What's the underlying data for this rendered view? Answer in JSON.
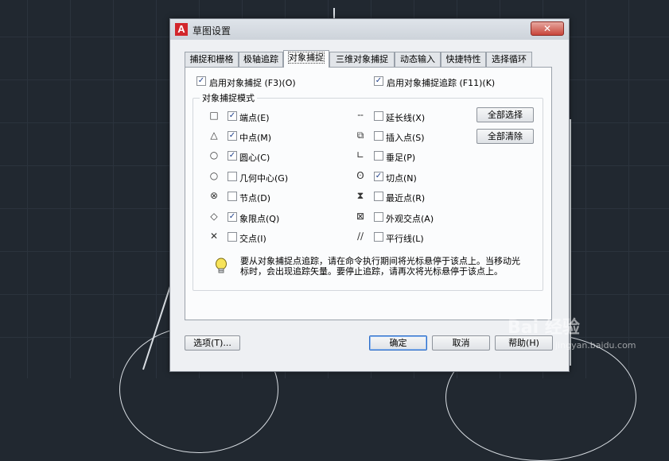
{
  "dialog": {
    "title": "草图设置",
    "app_icon": "A",
    "close_glyph": "✕"
  },
  "tabs": [
    {
      "label": "捕捉和栅格",
      "active": false
    },
    {
      "label": "极轴追踪",
      "active": false
    },
    {
      "label": "对象捕捉",
      "active": true
    },
    {
      "label": "三维对象捕捉",
      "active": false
    },
    {
      "label": "动态输入",
      "active": false
    },
    {
      "label": "快捷特性",
      "active": false
    },
    {
      "label": "选择循环",
      "active": false
    }
  ],
  "options": {
    "enable_osnap": {
      "label": "启用对象捕捉 (F3)(O)",
      "checked": true
    },
    "enable_tracking": {
      "label": "启用对象捕捉追踪 (F11)(K)",
      "checked": true
    }
  },
  "group_title": "对象捕捉模式",
  "modes_left": [
    {
      "label": "端点(E)",
      "checked": true,
      "icon": "square-icon",
      "glyph": "□"
    },
    {
      "label": "中点(M)",
      "checked": true,
      "icon": "triangle-icon",
      "glyph": "△"
    },
    {
      "label": "圆心(C)",
      "checked": true,
      "icon": "circle-icon",
      "glyph": "○"
    },
    {
      "label": "几何中心(G)",
      "checked": false,
      "icon": "geometric-center-icon",
      "glyph": "○"
    },
    {
      "label": "节点(D)",
      "checked": false,
      "icon": "node-icon",
      "glyph": "⊗"
    },
    {
      "label": "象限点(Q)",
      "checked": true,
      "icon": "diamond-icon",
      "glyph": "◇"
    },
    {
      "label": "交点(I)",
      "checked": false,
      "icon": "intersection-icon",
      "glyph": "✕"
    }
  ],
  "modes_right": [
    {
      "label": "延长线(X)",
      "checked": false,
      "icon": "extension-icon",
      "glyph": "╌"
    },
    {
      "label": "插入点(S)",
      "checked": false,
      "icon": "insert-icon",
      "glyph": "⧉"
    },
    {
      "label": "垂足(P)",
      "checked": false,
      "icon": "perpendicular-icon",
      "glyph": "∟"
    },
    {
      "label": "切点(N)",
      "checked": true,
      "icon": "tangent-icon",
      "glyph": "ʘ"
    },
    {
      "label": "最近点(R)",
      "checked": false,
      "icon": "nearest-icon",
      "glyph": "⧗"
    },
    {
      "label": "外观交点(A)",
      "checked": false,
      "icon": "apparent-intersection-icon",
      "glyph": "⊠"
    },
    {
      "label": "平行线(L)",
      "checked": false,
      "icon": "parallel-icon",
      "glyph": "∕∕"
    }
  ],
  "buttons": {
    "select_all": "全部选择",
    "clear_all": "全部清除",
    "options": "选项(T)...",
    "ok": "确定",
    "cancel": "取消",
    "help": "帮助(H)"
  },
  "hint": "要从对象捕捉点追踪，请在命令执行期间将光标悬停于该点上。当移动光标时，会出现追踪矢量。要停止追踪，请再次将光标悬停于该点上。",
  "watermark": "Bai 经验",
  "watermark_sub": "jingyan.baidu.com"
}
